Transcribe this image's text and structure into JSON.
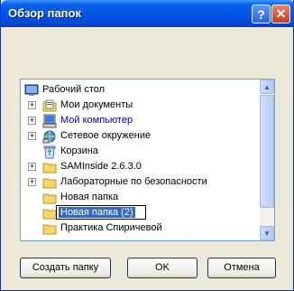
{
  "window": {
    "title": "Обзор папок",
    "help_glyph": "?",
    "close_glyph": "✕"
  },
  "tree": {
    "items": [
      {
        "label": "Рабочий стол",
        "icon": "desktop-icon"
      },
      {
        "label": "Мои документы",
        "icon": "documents-icon"
      },
      {
        "label": "Мой компьютер",
        "icon": "computer-icon"
      },
      {
        "label": "Сетевое окружение",
        "icon": "network-icon"
      },
      {
        "label": "Корзина",
        "icon": "recycle-bin-icon"
      },
      {
        "label": "SAMInside 2.6.3.0",
        "icon": "folder-icon"
      },
      {
        "label": "Лабораторные по безопасности",
        "icon": "folder-icon"
      },
      {
        "label": "Новая папка",
        "icon": "folder-icon"
      },
      {
        "label": "Новая папка (2)",
        "icon": "folder-icon"
      },
      {
        "label": "Практика Спиричевой",
        "icon": "folder-icon"
      }
    ],
    "expander_glyph": "+"
  },
  "buttons": {
    "create": "Создать папку",
    "ok": "OK",
    "cancel": "Отмена"
  }
}
